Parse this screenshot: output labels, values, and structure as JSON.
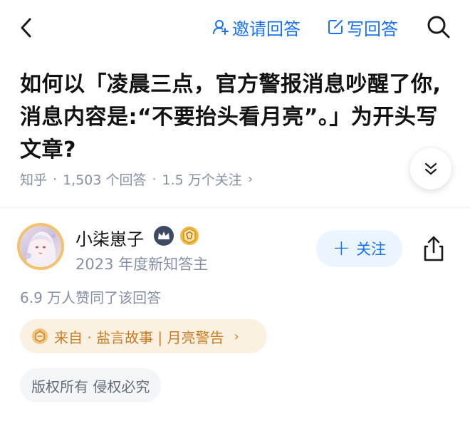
{
  "header": {
    "invite_label": "邀请回答",
    "write_label": "写回答"
  },
  "question": {
    "title": "如何以「凌晨三点，官方警报消息吵醒了你,消息内容是:“不要抬头看月亮”。」为开头写文章?",
    "source": "知乎",
    "answers_count": "1,503 个回答",
    "followers_count": "1.5 万个关注",
    "separator": "·",
    "chevron": "›"
  },
  "author": {
    "name": "小柒崽子",
    "badge_text": "2023 年度新知答主",
    "follow_label": "关注",
    "follow_icon": "+"
  },
  "answer": {
    "approval_text": "6.9 万人赞同了该回答",
    "source_pill_text": "来自 · 盐言故事 | 月亮警告",
    "source_pill_chevron": "›",
    "copyright_text": "版权所有 侵权必究"
  },
  "colors": {
    "accent": "#1772f6",
    "meta_gray": "#8590a6",
    "pill_orange": "#c97d23",
    "pill_bg": "#fbf1e2"
  }
}
